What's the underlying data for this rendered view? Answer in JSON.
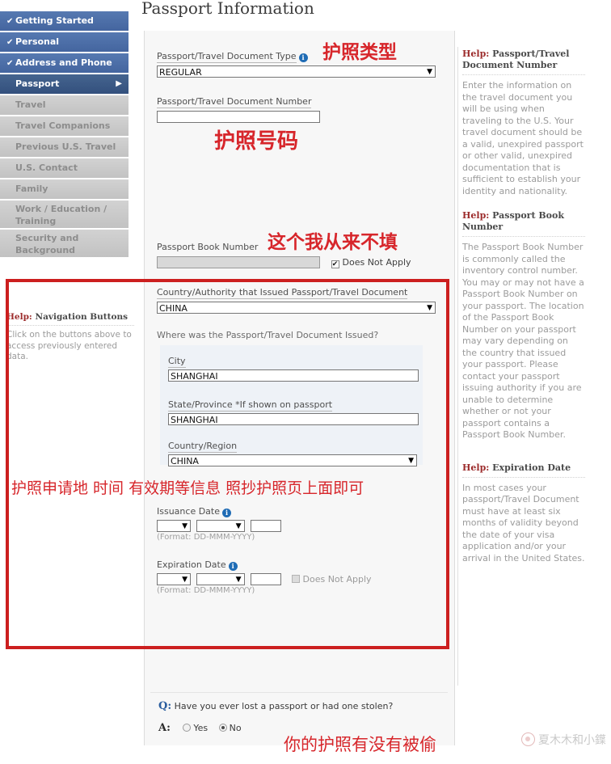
{
  "page": {
    "title": "Passport Information"
  },
  "sidebar": {
    "items": [
      {
        "label": "Getting Started",
        "state": "complete",
        "check": "✔"
      },
      {
        "label": "Personal",
        "state": "complete",
        "check": "✔"
      },
      {
        "label": "Address and Phone",
        "state": "complete",
        "check": "✔"
      },
      {
        "label": "Passport",
        "state": "active",
        "arrow": "▶"
      },
      {
        "label": "Travel",
        "state": "disabled"
      },
      {
        "label": "Travel Companions",
        "state": "disabled"
      },
      {
        "label": "Previous U.S. Travel",
        "state": "disabled"
      },
      {
        "label": "U.S. Contact",
        "state": "disabled"
      },
      {
        "label": "Family",
        "state": "disabled"
      },
      {
        "label": "Work / Education / Training",
        "state": "disabled"
      },
      {
        "label": "Security and Background",
        "state": "disabled"
      }
    ]
  },
  "nav_help": {
    "title_word": "Help:",
    "title_rest": " Navigation Buttons",
    "body": "Click on the buttons above to access previously entered data."
  },
  "form": {
    "doc_type": {
      "label": "Passport/Travel Document Type",
      "value": "REGULAR",
      "info_glyph": "i",
      "arrow": "▼"
    },
    "doc_number": {
      "label": "Passport/Travel Document Number",
      "value": ""
    },
    "book_number": {
      "label": "Passport Book Number",
      "value": "",
      "does_not_apply_label": "Does Not Apply",
      "does_not_apply_checked": true
    },
    "issuing_country": {
      "label": "Country/Authority that Issued Passport/Travel Document",
      "value": "CHINA",
      "arrow": "▼"
    },
    "issued_where": {
      "heading": "Where was the Passport/Travel Document Issued?",
      "city": {
        "label": "City",
        "value": "SHANGHAI"
      },
      "state": {
        "label": "State/Province *If shown on passport",
        "value": "SHANGHAI"
      },
      "country": {
        "label": "Country/Region",
        "value": "CHINA",
        "arrow": "▼"
      }
    },
    "issuance_date": {
      "label": "Issuance Date",
      "day": "",
      "month": "",
      "year": "",
      "format": "(Format: DD-MMM-YYYY)",
      "arrow": "▼"
    },
    "expiration_date": {
      "label": "Expiration Date",
      "day": "",
      "month": "",
      "year": "",
      "format": "(Format: DD-MMM-YYYY)",
      "does_not_apply_label": "Does Not Apply",
      "does_not_apply_checked": false,
      "arrow": "▼"
    }
  },
  "right_help": {
    "blocks": [
      {
        "title_word": "Help:",
        "title_rest": " Passport/Travel Document Number",
        "body": "Enter the information on the travel document you will be using when traveling to the U.S. Your travel document should be a valid, unexpired passport or other valid, unexpired documentation that is sufficient to establish your identity and nationality."
      },
      {
        "title_word": "Help:",
        "title_rest": " Passport Book Number",
        "body": "The Passport Book Number is commonly called the inventory control number. You may or may not have a Passport Book Number on your passport. The location of the Passport Book Number on your passport may vary depending on the country that issued your passport. Please contact your passport issuing authority if you are unable to determine whether or not your passport contains a Passport Book Number."
      },
      {
        "title_word": "Help:",
        "title_rest": " Expiration Date",
        "body": "In most cases your passport/Travel Document must have at least six months of validity beyond the date of your visa application and/or your arrival in the United States."
      }
    ]
  },
  "question": {
    "q_mark": "Q:",
    "q_text": "Have you ever lost a passport or had one stolen?",
    "a_mark": "A:",
    "options": [
      {
        "label": "Yes",
        "selected": false
      },
      {
        "label": "No",
        "selected": true
      }
    ]
  },
  "annotations": [
    {
      "id": "anno-doc-type",
      "text": "护照类型"
    },
    {
      "id": "anno-doc-number",
      "text": "护照号码"
    },
    {
      "id": "anno-book-number",
      "text": "这个我从来不填"
    },
    {
      "id": "anno-redbox",
      "text": "护照申请地 时间  有效期等信息  照抄护照页上面即可"
    },
    {
      "id": "anno-question",
      "text": "你的护照有没有被偷"
    }
  ],
  "watermark": {
    "text": "夏木木和小鐷"
  },
  "colors": {
    "nav_active": "#3c5a8a",
    "nav_complete": "#4a6da7",
    "nav_disabled": "#c9c9c9",
    "annotation_red": "#d7262b",
    "redbox_border": "#cc1f1f",
    "help_heading": "#9c2b2b"
  }
}
